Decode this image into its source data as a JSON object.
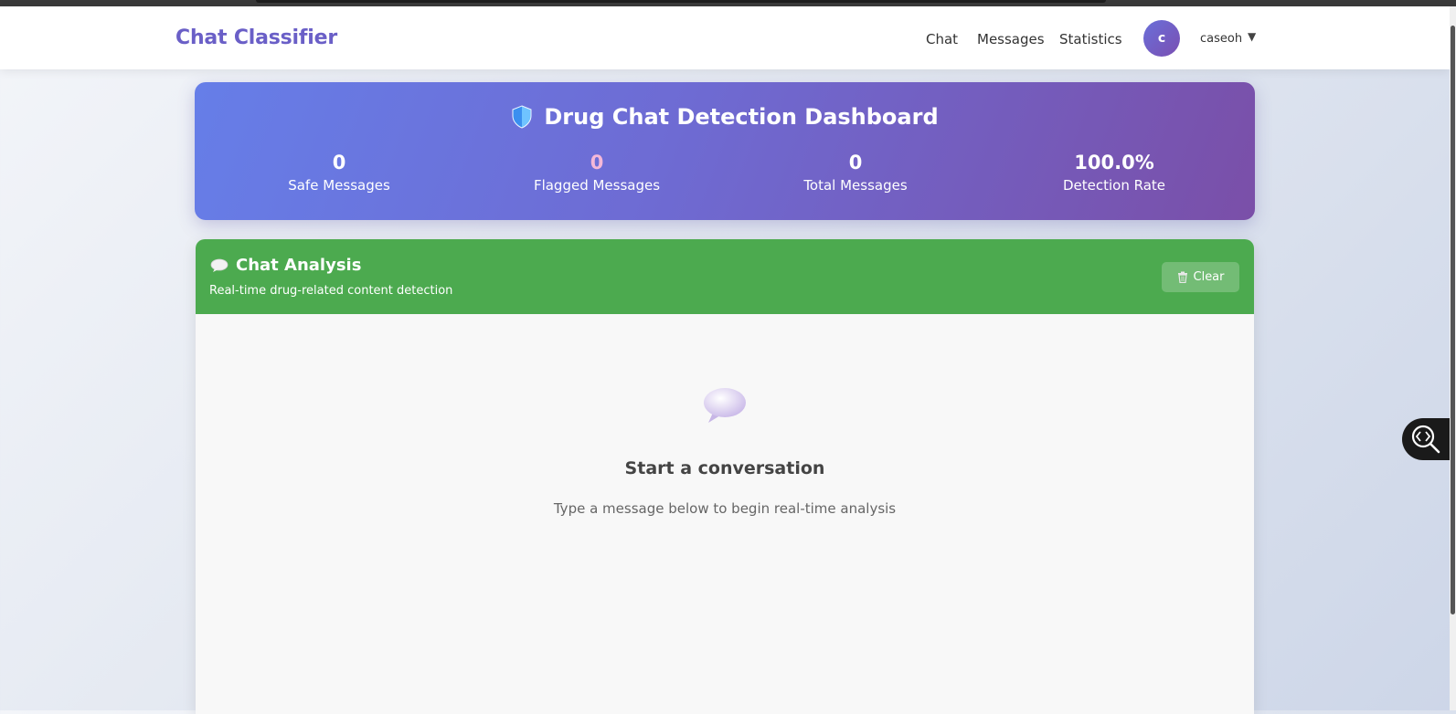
{
  "navbar": {
    "brand": "Chat Classifier",
    "links": [
      "Chat",
      "Messages",
      "Statistics"
    ],
    "user": {
      "initial": "c",
      "name": "caseoh",
      "caret": "▼"
    }
  },
  "dashboard": {
    "title": "Drug Chat Detection Dashboard",
    "icon": "shield-icon",
    "stats": [
      {
        "value": "0",
        "label": "Safe Messages",
        "color": "#ffffff"
      },
      {
        "value": "0",
        "label": "Flagged Messages",
        "color": "#f5b8d8"
      },
      {
        "value": "0",
        "label": "Total Messages",
        "color": "#ffffff"
      },
      {
        "value": "100.0%",
        "label": "Detection Rate",
        "color": "#ffffff"
      }
    ]
  },
  "chat": {
    "title": "Chat Analysis",
    "subtitle": "Real-time drug-related content detection",
    "clear_label": "Clear",
    "empty_title": "Start a conversation",
    "empty_desc": "Type a message below to begin real-time analysis"
  },
  "colors": {
    "brand": "#6a5fc7",
    "dashboard_gradient": [
      "#667ee8",
      "#7a4fa8"
    ],
    "chat_header": "#4caa4f"
  }
}
